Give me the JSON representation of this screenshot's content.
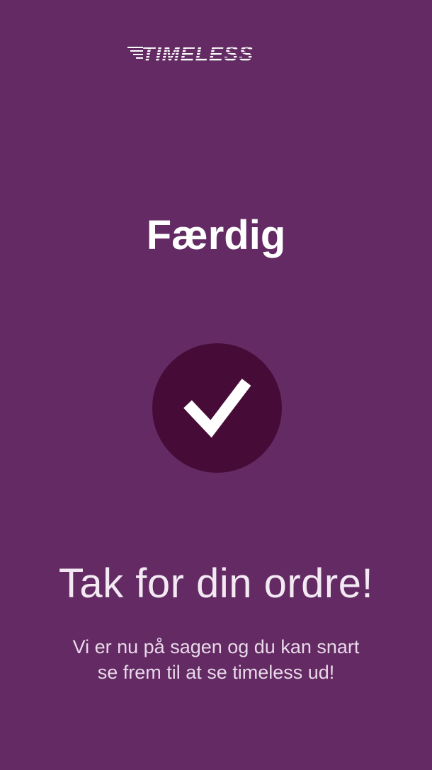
{
  "brand": {
    "logo_text": "TIMELESS"
  },
  "status": {
    "title": "Færdig",
    "icon": "checkmark-icon"
  },
  "confirmation": {
    "heading": "Tak for din ordre!",
    "message_line1": "Vi er nu på sagen og du kan snart",
    "message_line2": "se frem til at se timeless ud!"
  },
  "colors": {
    "background": "#632a63",
    "circle": "#470b38",
    "text": "#ffffff"
  }
}
